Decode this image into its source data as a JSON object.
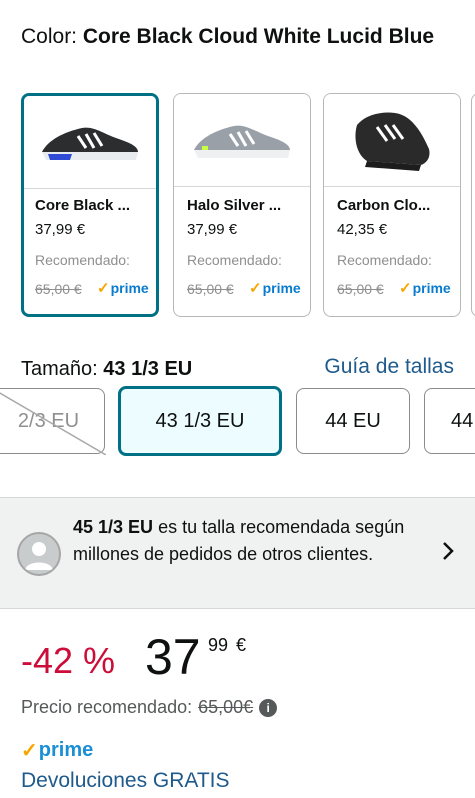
{
  "color": {
    "label": "Color:",
    "value": "Core Black Cloud White Lucid Blue"
  },
  "swatches": [
    {
      "name": "Core Black ...",
      "price": "37,99 €",
      "rec_label": "Recomendado:",
      "list_price": "65,00 €",
      "prime": "prime",
      "selected": true,
      "shoe_color": "#2b2d2f",
      "accent": "#2f4bd6"
    },
    {
      "name": "Halo Silver ...",
      "price": "37,99 €",
      "rec_label": "Recomendado:",
      "list_price": "65,00 €",
      "prime": "prime",
      "selected": false,
      "shoe_color": "#9aa0a8",
      "accent": "#c8ff40"
    },
    {
      "name": "Carbon Clo...",
      "price": "42,35 €",
      "rec_label": "Recomendado:",
      "list_price": "65,00 €",
      "prime": "prime",
      "selected": false,
      "shoe_color": "#2a2a2a",
      "accent": "#2a2a2a"
    }
  ],
  "size": {
    "label": "Tamaño:",
    "value": "43 1/3 EU",
    "guide": "Guía de tallas"
  },
  "sizes": [
    {
      "label": "2/3 EU",
      "state": "unavailable"
    },
    {
      "label": "43 1/3 EU",
      "state": "selected"
    },
    {
      "label": "44 EU",
      "state": "available"
    },
    {
      "label": "44",
      "state": "available"
    }
  ],
  "recommendation": {
    "size": "45 1/3 EU",
    "text": " es tu talla recomendada según millones de pedidos de otros clientes."
  },
  "price": {
    "discount": "-42 %",
    "whole": "37",
    "fraction": "99",
    "currency": "€"
  },
  "list_price": {
    "label": "Precio recomendado:",
    "value": "65,00€"
  },
  "prime": "prime",
  "returns": "Devoluciones GRATIS",
  "colors": {
    "teal": "#007185",
    "link": "#1e5a8c",
    "discount": "#cc0c39",
    "prime": "#1a8fd6"
  }
}
